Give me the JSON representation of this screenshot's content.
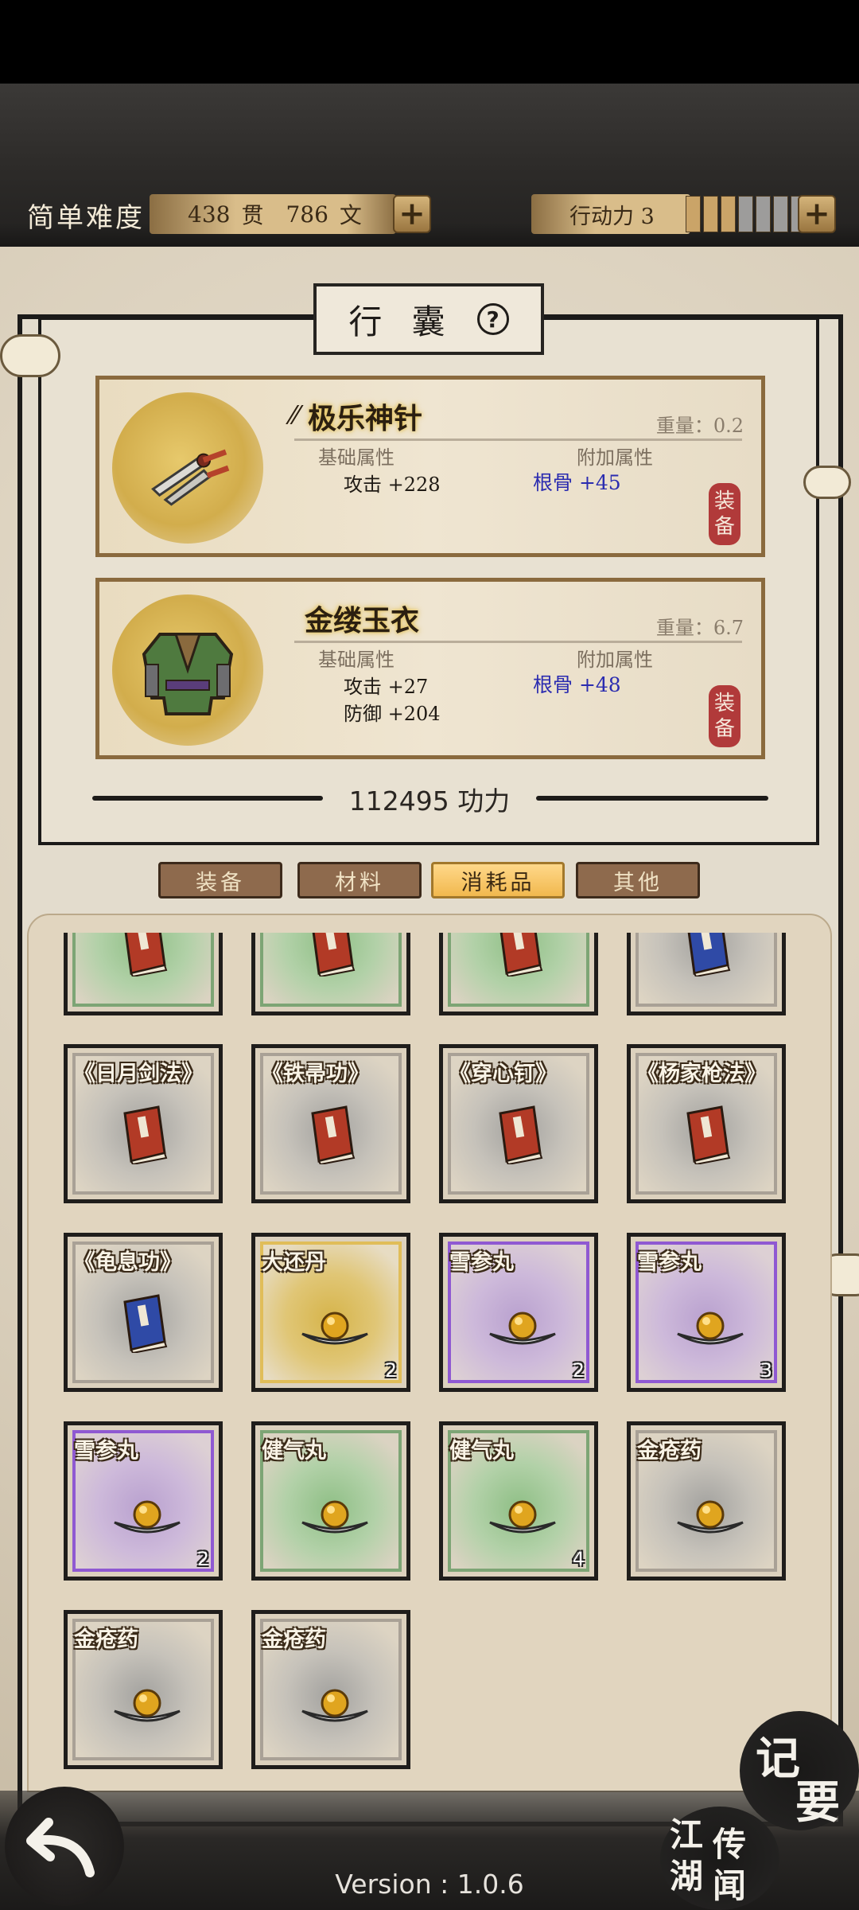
{
  "header": {
    "difficulty": "简单难度",
    "money_guan": "438",
    "money_guan_unit": "贯",
    "money_wen": "786",
    "money_wen_unit": "文",
    "action_label": "行动力 3",
    "action_level": 3,
    "action_max": 7,
    "plus": "+"
  },
  "panel": {
    "title": "行 囊",
    "help": "?"
  },
  "equipped": [
    {
      "name": "极乐神针",
      "weight": "重量：0.2",
      "base_label": "基础属性",
      "extra_label": "附加属性",
      "base_stats": [
        "攻击 +228"
      ],
      "extra_stats": [
        "根骨 +45"
      ],
      "seal": [
        "装",
        "备"
      ]
    },
    {
      "name": "金缕玉衣",
      "weight": "重量：6.7",
      "base_label": "基础属性",
      "extra_label": "附加属性",
      "base_stats": [
        "攻击 +27",
        "防御 +204"
      ],
      "extra_stats": [
        "根骨 +48"
      ],
      "seal": [
        "装",
        "备"
      ]
    }
  ],
  "power": "112495 功力",
  "tabs": [
    "装备",
    "材料",
    "消耗品",
    "其他"
  ],
  "active_tab": 2,
  "items_partial_row": [
    {
      "rarity": "green",
      "icon": "book-red-icon"
    },
    {
      "rarity": "green",
      "icon": "book-red-icon"
    },
    {
      "rarity": "green",
      "icon": "book-red-icon"
    },
    {
      "rarity": "gray",
      "icon": "book-blue-icon"
    }
  ],
  "items": [
    {
      "name": "《日月剑法》",
      "rarity": "gray",
      "icon": "book-red-icon",
      "count": ""
    },
    {
      "name": "《铁帚功》",
      "rarity": "gray",
      "icon": "book-red-icon",
      "count": ""
    },
    {
      "name": "《穿心钉》",
      "rarity": "gray",
      "icon": "book-red-icon",
      "count": ""
    },
    {
      "name": "《杨家枪法》",
      "rarity": "gray",
      "icon": "book-red-icon",
      "count": ""
    },
    {
      "name": "《龟息功》",
      "rarity": "gray",
      "icon": "book-blue-icon",
      "count": ""
    },
    {
      "name": "大还丹",
      "rarity": "gold",
      "icon": "pill-icon",
      "count": "2"
    },
    {
      "name": "雪参丸",
      "rarity": "purple",
      "icon": "pill-icon",
      "count": "2"
    },
    {
      "name": "雪参丸",
      "rarity": "purple",
      "icon": "pill-icon",
      "count": "3"
    },
    {
      "name": "雪参丸",
      "rarity": "purple",
      "icon": "pill-icon",
      "count": "2"
    },
    {
      "name": "健气丸",
      "rarity": "green",
      "icon": "pill-icon",
      "count": ""
    },
    {
      "name": "健气丸",
      "rarity": "green",
      "icon": "pill-icon",
      "count": "4"
    },
    {
      "name": "金疮药",
      "rarity": "gray",
      "icon": "pill-icon",
      "count": ""
    },
    {
      "name": "金疮药",
      "rarity": "gray",
      "icon": "pill-icon",
      "count": ""
    },
    {
      "name": "金疮药",
      "rarity": "gray",
      "icon": "pill-icon",
      "count": ""
    }
  ],
  "bottom": {
    "version": "Version : 1.0.6",
    "notes_button": [
      "记",
      "要"
    ],
    "rumors_button": [
      "江",
      "湖",
      "传",
      "闻"
    ]
  },
  "colors": {
    "active_tab": "#f1b84e",
    "extra_stat": "#2b2cb0",
    "seal": "#b13a3a"
  }
}
